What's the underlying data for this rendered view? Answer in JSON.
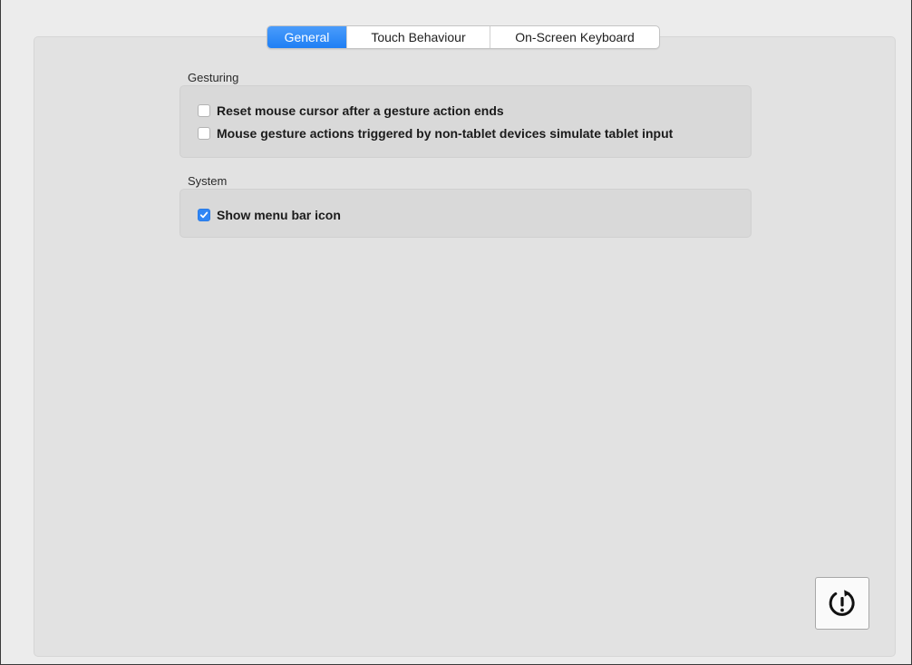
{
  "tabs": [
    {
      "label": "General",
      "active": true
    },
    {
      "label": "Touch Behaviour",
      "active": false
    },
    {
      "label": "On-Screen Keyboard",
      "active": false
    }
  ],
  "sections": {
    "gesturing": {
      "label": "Gesturing",
      "options": [
        {
          "label": "Reset mouse cursor after a gesture action ends",
          "checked": false
        },
        {
          "label": "Mouse gesture actions triggered by non-tablet devices simulate tablet input",
          "checked": false
        }
      ]
    },
    "system": {
      "label": "System",
      "options": [
        {
          "label": "Show menu bar icon",
          "checked": true
        }
      ]
    }
  },
  "footer": {
    "restart_icon": "restart-alert-icon"
  },
  "colors": {
    "accent": "#2f86f5",
    "panel_bg": "#e2e2e2",
    "group_bg": "#d9d9d9"
  }
}
